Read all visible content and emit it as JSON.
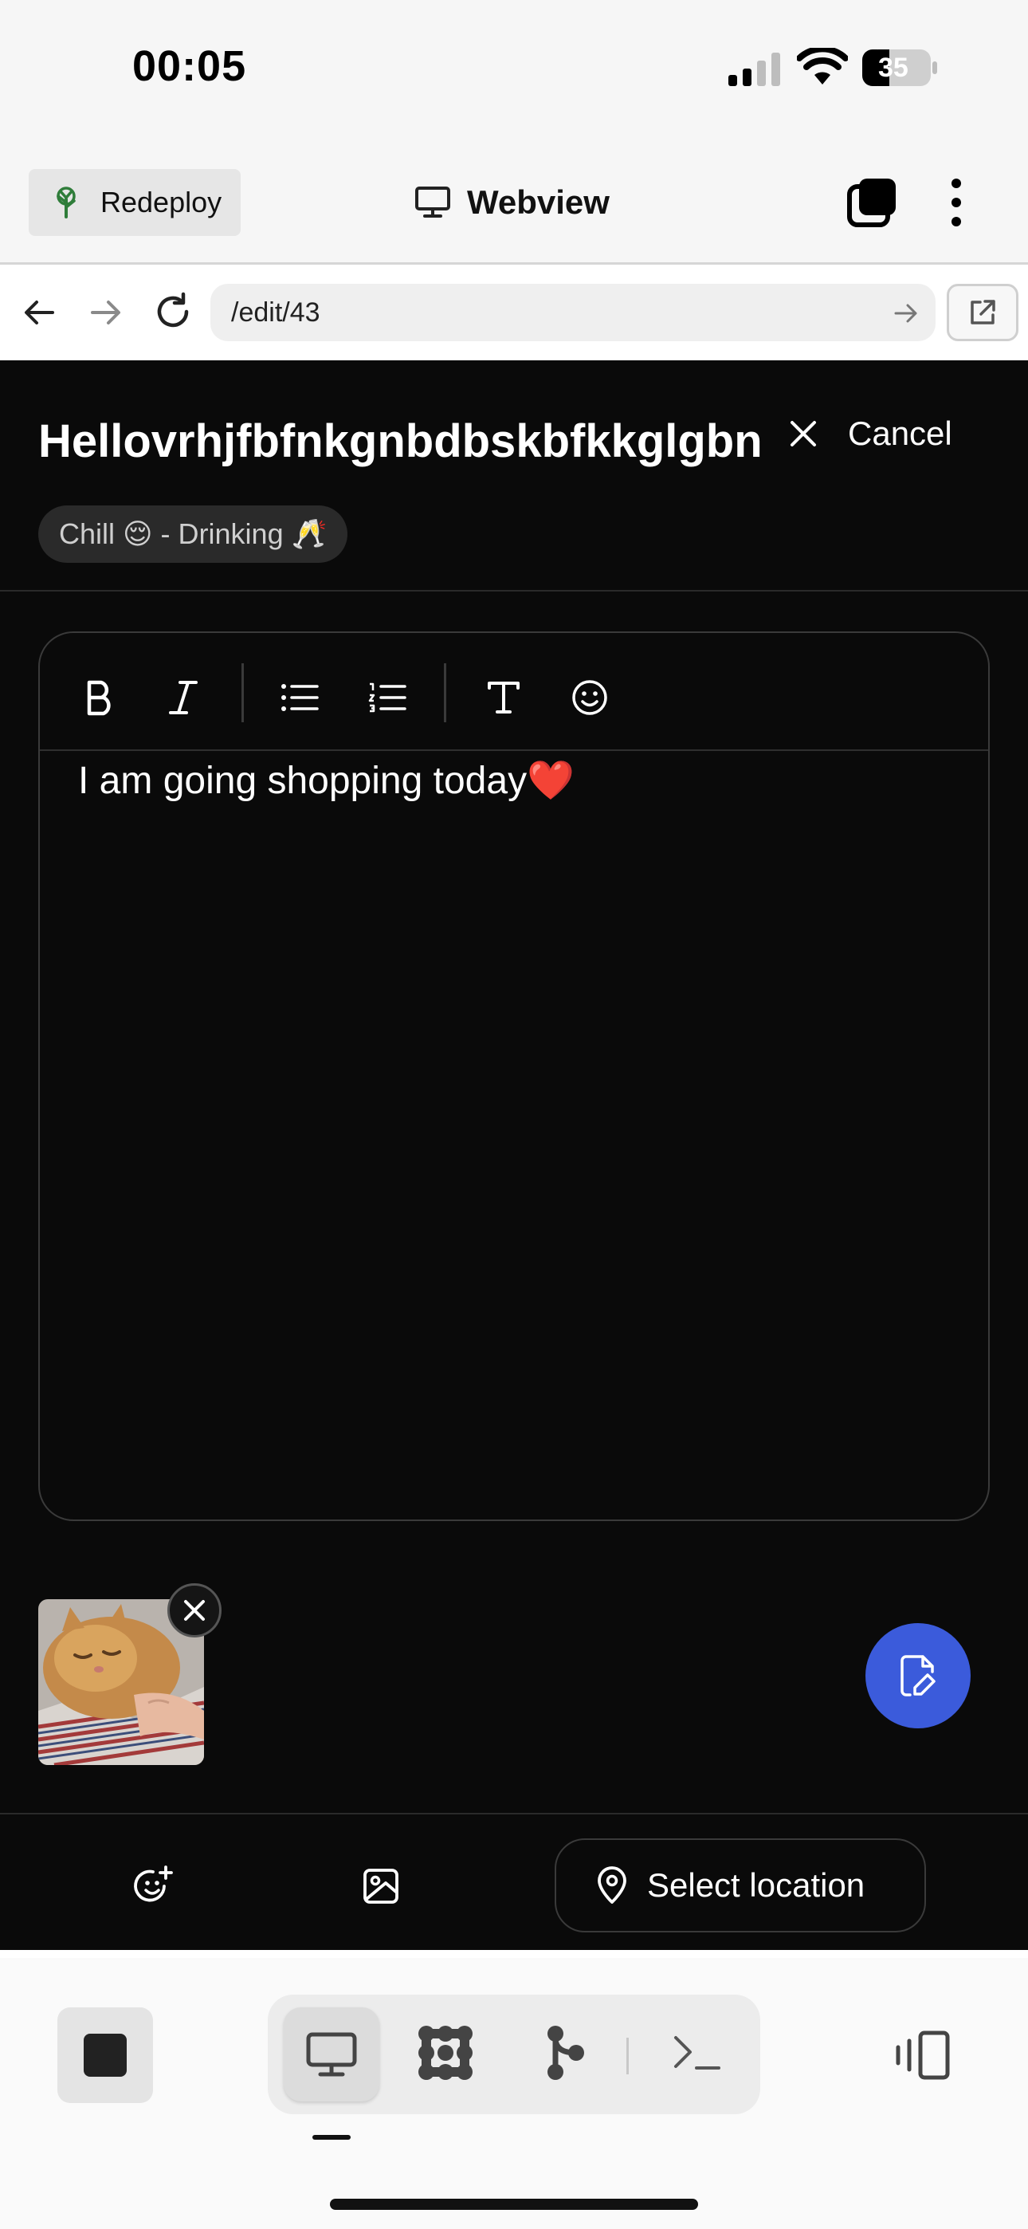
{
  "status_bar": {
    "time": "00:05",
    "battery": "35"
  },
  "header": {
    "redeploy_label": "Redeploy",
    "title": "Webview"
  },
  "url_bar": {
    "url": "/edit/43"
  },
  "entry": {
    "title": "Hellovrhjfbfnkgnbdbskbfkkglgbn",
    "cancel_label": "Cancel",
    "mood_chip": "Chill 😌 - Drinking 🥂",
    "body_text": "I am going shopping today❤️"
  },
  "bottom_actions": {
    "select_location_label": "Select location"
  },
  "colors": {
    "accent": "#3b5bdb",
    "background_dark": "#0a0a0a",
    "header_bg": "#f6f6f6"
  },
  "icons": {
    "redeploy": "tree-icon",
    "webview": "monitor-icon",
    "tabs": "tabs-icon",
    "menu": "more-vertical-icon",
    "back": "arrow-left-icon",
    "forward": "arrow-right-icon",
    "reload": "reload-icon",
    "go": "arrow-right-icon",
    "open_external": "external-link-icon",
    "close": "close-icon",
    "bold": "bold-icon",
    "italic": "italic-icon",
    "bullet_list": "bullet-list-icon",
    "numbered_list": "numbered-list-icon",
    "text_style": "text-icon",
    "emoji": "smiley-icon",
    "save": "file-edit-icon",
    "mood_add": "smiley-plus-icon",
    "image_add": "image-icon",
    "location": "location-pin-icon"
  }
}
